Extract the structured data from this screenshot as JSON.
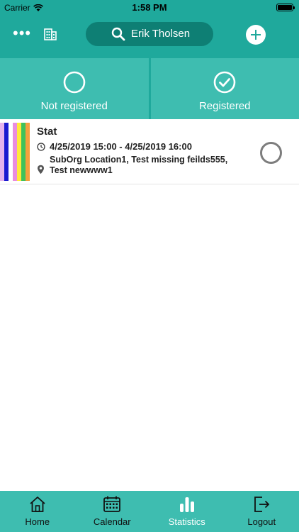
{
  "status_bar": {
    "carrier": "Carrier",
    "time": "1:58 PM"
  },
  "header": {
    "more_icon": "ellipsis-icon",
    "org_icon": "building-icon",
    "search_text": "Erik  Tholsen",
    "add_icon": "plus-circle-icon"
  },
  "tabs": [
    {
      "label": "Not registered",
      "icon": "circle-outline-icon"
    },
    {
      "label": "Registered",
      "icon": "check-circle-icon"
    }
  ],
  "event": {
    "title": "Stat",
    "time_range": "4/25/2019 15:00 - 4/25/2019 16:00",
    "location": "SubOrg Location1, Test missing feilds555, Test newwww1",
    "stripe_colors": [
      "#e4b4ec",
      "#1a1ad0",
      "#ffffff",
      "#e98ddf",
      "#ffe93b",
      "#3ec25a",
      "#f4a03c"
    ],
    "status": "not-registered"
  },
  "bottom_nav": [
    {
      "label": "Home",
      "icon": "home-icon",
      "active": false
    },
    {
      "label": "Calendar",
      "icon": "calendar-icon",
      "active": false
    },
    {
      "label": "Statistics",
      "icon": "bar-chart-icon",
      "active": true
    },
    {
      "label": "Logout",
      "icon": "logout-icon",
      "active": false
    }
  ],
  "colors": {
    "primary": "#1fa99c",
    "tab_background": "#3ebdb0",
    "search_background": "#0e7f74"
  }
}
